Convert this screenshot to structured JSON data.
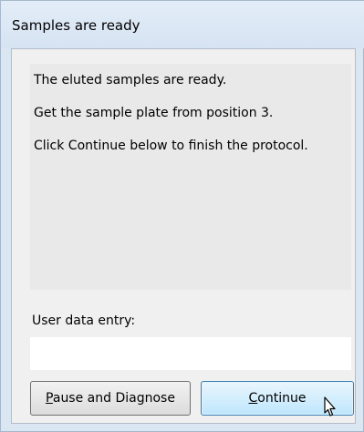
{
  "window": {
    "title": "Samples are ready"
  },
  "message": {
    "lines": [
      "The eluted samples are ready.",
      "Get the sample plate from position 3.",
      "Click Continue below to finish the protocol."
    ]
  },
  "user_entry": {
    "label": "User data entry:",
    "value": ""
  },
  "buttons": {
    "pause": {
      "mnemonic": "P",
      "rest": "ause and Diagnose"
    },
    "continue": {
      "mnemonic": "C",
      "rest": "ontinue"
    }
  },
  "icons": {
    "cursor": "mouse-pointer-icon"
  },
  "colors": {
    "frame": "#dbe6f3",
    "continue_button": "#bee6fd",
    "continue_border": "#3c7fb1"
  }
}
